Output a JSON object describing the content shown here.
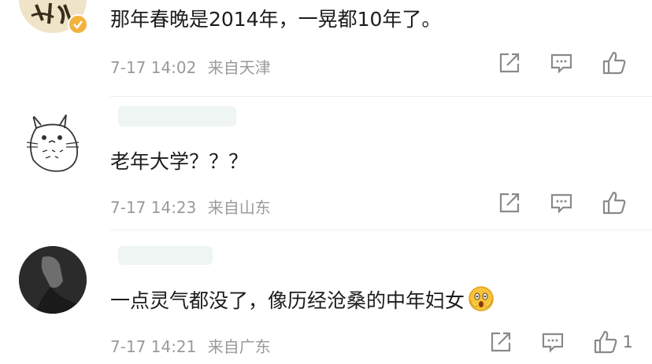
{
  "comments": [
    {
      "text": "那年春晚是2014年，一晃都10年了。",
      "date": "7-17 14:02",
      "location": "来自天津",
      "likes": "",
      "avatar_glyph": "小"
    },
    {
      "text": "老年大学？？？",
      "date": "7-17 14:23",
      "location": "来自山东",
      "likes": ""
    },
    {
      "text": "一点灵气都没了，像历经沧桑的中年妇女",
      "emoji": "😱",
      "date": "7-17 14:21",
      "location": "来自广东",
      "likes": "1"
    }
  ],
  "colors": {
    "text": "#1c1c1c",
    "meta": "#9a9a9a",
    "icon": "#8a8a8a",
    "verified_badge": "#f2b33d"
  },
  "icons": [
    "share-icon",
    "comment-icon",
    "like-icon",
    "verified-badge-icon",
    "scared-emoji-icon"
  ]
}
